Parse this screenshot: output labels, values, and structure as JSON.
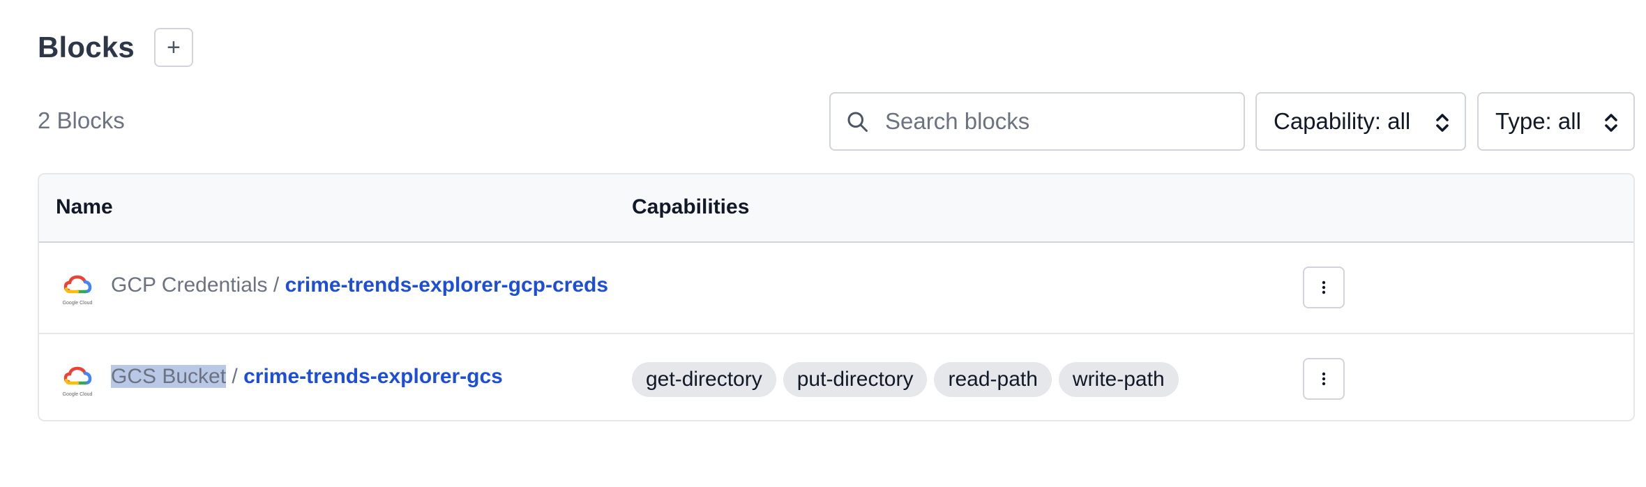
{
  "header": {
    "title": "Blocks",
    "add_label": "+"
  },
  "toolbar": {
    "count_label": "2 Blocks",
    "search": {
      "placeholder": "Search blocks",
      "value": ""
    },
    "capability_filter": {
      "label": "Capability: all"
    },
    "type_filter": {
      "label": "Type: all"
    }
  },
  "table": {
    "columns": [
      "Name",
      "Capabilities"
    ],
    "rows": [
      {
        "logo": "google-cloud-logo",
        "logo_text": "Google Cloud",
        "block_type": "GCP Credentials",
        "separator": " / ",
        "block_name": "crime-trends-explorer-gcp-creds",
        "capabilities": []
      },
      {
        "logo": "google-cloud-logo",
        "logo_text": "Google Cloud",
        "block_type": "GCS Bucket",
        "separator": " / ",
        "block_name": "crime-trends-explorer-gcs",
        "capabilities": [
          "get-directory",
          "put-directory",
          "read-path",
          "write-path"
        ]
      }
    ]
  },
  "icons": {
    "search": "search-icon",
    "chevron": "chevron-up-down-icon",
    "menu": "kebab-menu-icon"
  },
  "colors": {
    "link": "#1d4ed8",
    "muted_text": "#6b7280",
    "border": "#d1d5db",
    "tag_bg": "#e5e7eb"
  }
}
